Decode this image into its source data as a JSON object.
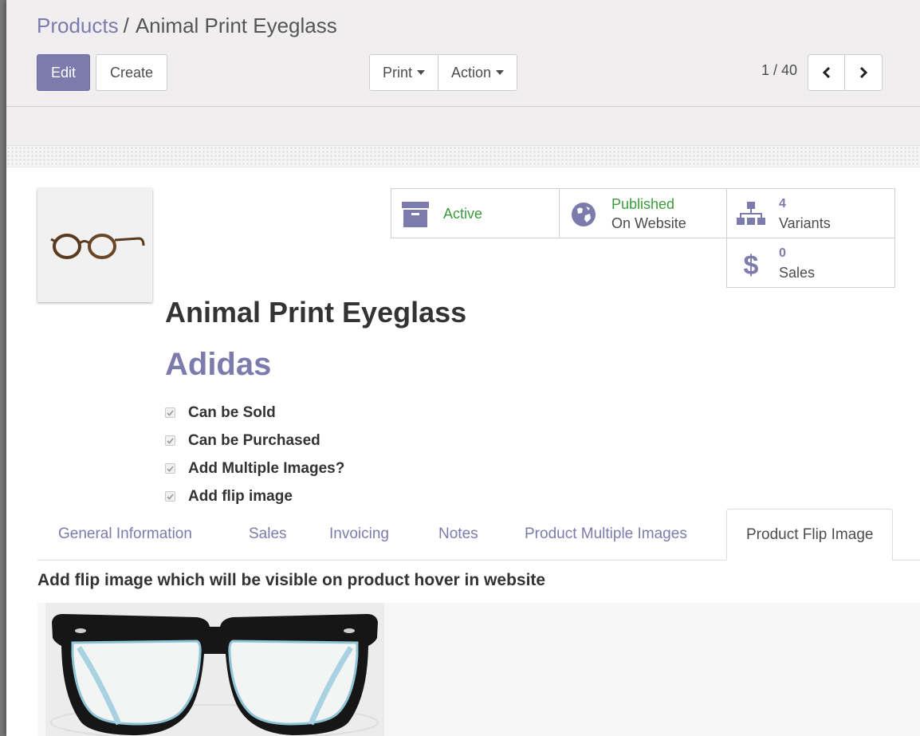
{
  "breadcrumb": {
    "parent": "Products",
    "separator": "/",
    "current": "Animal Print Eyeglass"
  },
  "toolbar": {
    "edit_label": "Edit",
    "create_label": "Create",
    "print_label": "Print",
    "action_label": "Action"
  },
  "pager": {
    "value": "1 / 40"
  },
  "smart_buttons": {
    "active": {
      "label": "Active",
      "icon": "archive-icon"
    },
    "website": {
      "line1": "Published",
      "line2": "On Website",
      "icon": "globe-icon"
    },
    "variants": {
      "count": "4",
      "label": "Variants",
      "icon": "sitemap-icon"
    },
    "sales": {
      "count": "0",
      "label": "Sales",
      "icon": "dollar-icon"
    }
  },
  "product": {
    "name": "Animal Print Eyeglass",
    "brand": "Adidas"
  },
  "checkboxes": [
    {
      "label": "Can be Sold",
      "checked": true
    },
    {
      "label": "Can be Purchased",
      "checked": true
    },
    {
      "label": "Add Multiple Images?",
      "checked": true
    },
    {
      "label": "Add flip image",
      "checked": true
    }
  ],
  "tabs": [
    "General Information",
    "Sales",
    "Invoicing",
    "Notes",
    "Product Multiple Images",
    "Product Flip Image"
  ],
  "active_tab": "Product Flip Image",
  "flip": {
    "label": "Add flip image which will be visible on product hover in website"
  },
  "colors": {
    "accent": "#7c7bad",
    "published_green": "#3c9c3c"
  }
}
